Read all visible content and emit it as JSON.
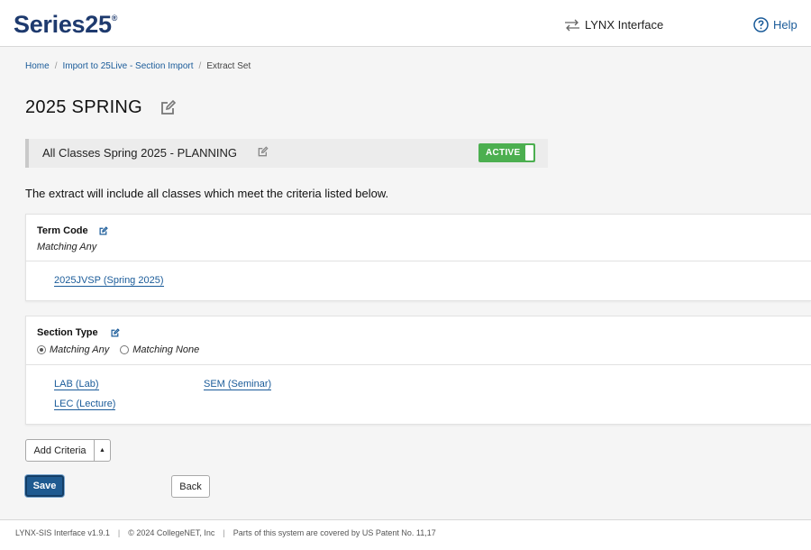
{
  "header": {
    "logo_text": "Series25",
    "logo_mark": "®",
    "interface_label": "LYNX Interface",
    "help_label": "Help",
    "brand_color": "#1e3a6e"
  },
  "breadcrumb": {
    "items": [
      "Home",
      "Import to 25Live - Section Import",
      "Extract Set"
    ],
    "separator": "/"
  },
  "page": {
    "title": "2025 SPRING",
    "set_name": "All Classes Spring 2025 - PLANNING",
    "status_label": "ACTIVE",
    "description": "The extract will include all classes which meet the criteria listed below."
  },
  "criteria": [
    {
      "title": "Term Code",
      "mode": "Matching Any",
      "values": [
        "2025JVSP (Spring 2025)"
      ]
    },
    {
      "title": "Section Type",
      "options": [
        "Matching Any",
        "Matching None"
      ],
      "selected": "Matching Any",
      "values": [
        "LAB (Lab)",
        "SEM (Seminar)",
        "LEC (Lecture)"
      ]
    }
  ],
  "buttons": {
    "add_criteria": "Add Criteria",
    "save": "Save",
    "back": "Back"
  },
  "footer": {
    "version": "LYNX-SIS Interface v1.9.1",
    "copyright": "© 2024 CollegeNET, Inc",
    "patent": "Parts of this system are covered by US Patent No. 11,17"
  },
  "icons": {
    "swap": "swap-arrows-icon",
    "help": "question-circle-icon",
    "edit": "edit-pencil-icon",
    "caret": "caret-up-icon"
  },
  "colors": {
    "link": "#1a5b99",
    "active": "#4caf50",
    "save": "#1f5a90"
  }
}
